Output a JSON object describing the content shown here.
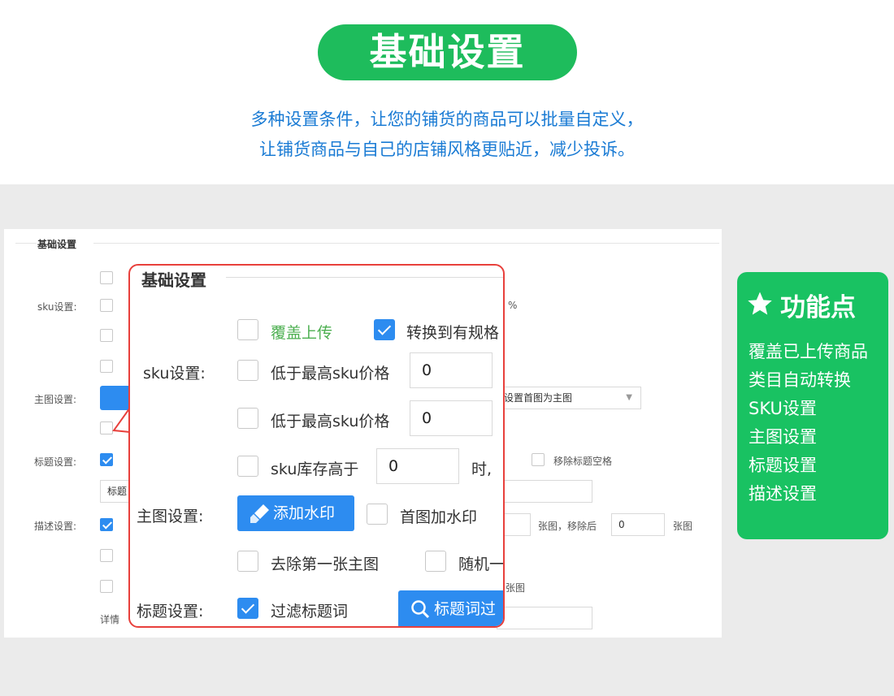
{
  "header": {
    "title": "基础设置",
    "subtitle_line1": "多种设置条件，让您的铺货的商品可以批量自定义，",
    "subtitle_line2": "让铺货商品与自己的店铺风格更贴近，减少投诉。"
  },
  "panel": {
    "section_title": "基础设置",
    "sku_label": "sku设置:",
    "sku_percent": "%",
    "main_label": "主图设置:",
    "main_select": "设置首图为主图",
    "title_label": "标题设置:",
    "title_remove_space": "移除标题空格",
    "title_input_prefix": "标题",
    "desc_label": "描述设置:",
    "desc_unit1": "张图，移除后",
    "desc_value": "0",
    "desc_unit2": "张图",
    "desc_unit3": "张图",
    "detail_prefix": "详情"
  },
  "zoom": {
    "section_title": "基础设置",
    "cover_upload": "覆盖上传",
    "convert_spec": "转换到有规格",
    "sku_label": "sku设置:",
    "lower_than_max_1": "低于最高sku价格",
    "value_1": "0",
    "lower_than_max_2": "低于最高sku价格",
    "value_2": "0",
    "stock_higher": "sku库存高于",
    "value_3": "0",
    "when": "时,",
    "main_label": "主图设置:",
    "add_watermark_button": "添加水印",
    "first_image_watermark": "首图加水印",
    "remove_first_main": "去除第一张主图",
    "random": "随机一",
    "title_label": "标题设置:",
    "filter_title_words": "过滤标题词",
    "title_words_button": "标题词过"
  },
  "features": {
    "heading": "功能点",
    "items": [
      "覆盖已上传商品",
      "类目自动转换",
      "SKU设置",
      "主图设置",
      "标题设置",
      "描述设置"
    ]
  },
  "colors": {
    "green": "#1ebc5c",
    "blue": "#2d8cf0",
    "red_border": "#e8403c",
    "subtitle_blue": "#1a7bd4"
  }
}
